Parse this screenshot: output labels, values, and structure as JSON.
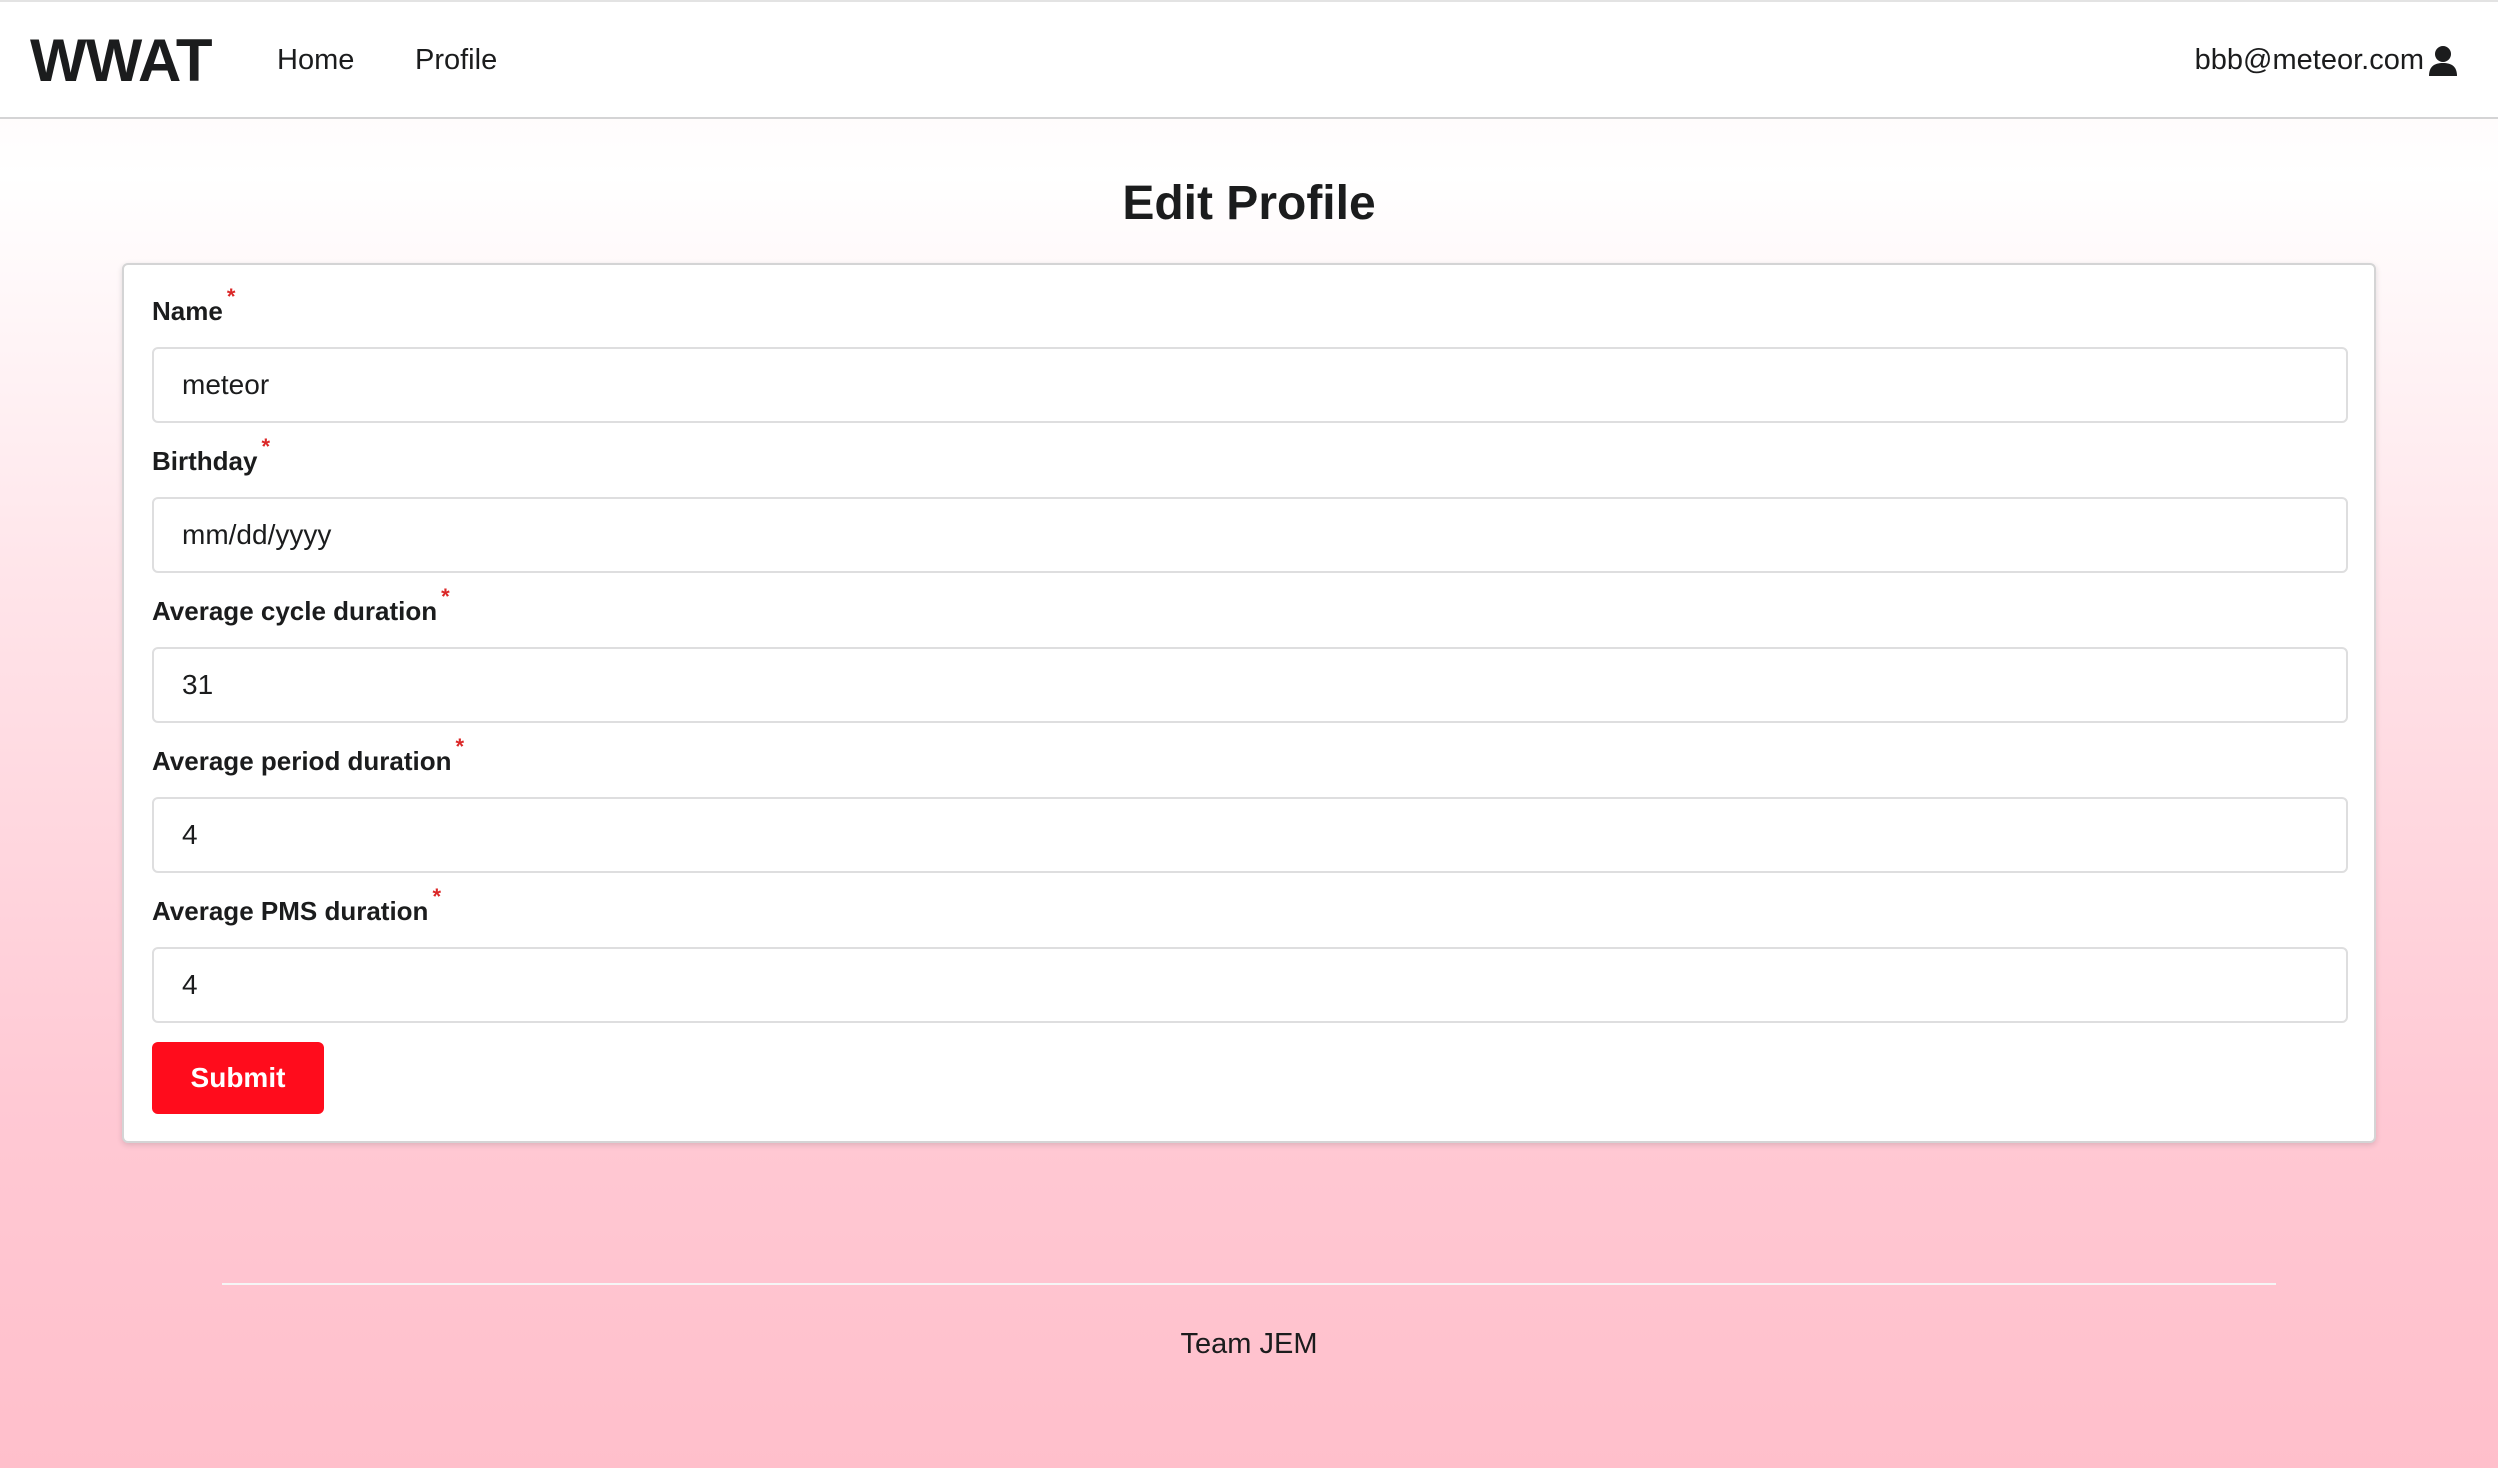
{
  "navbar": {
    "brand": "WWAT",
    "items": [
      {
        "label": "Home"
      },
      {
        "label": "Profile"
      }
    ],
    "user_email": "bbb@meteor.com",
    "user_icon": "user-icon"
  },
  "page": {
    "title": "Edit Profile"
  },
  "form": {
    "required_marker": "*",
    "fields": [
      {
        "label": "Name",
        "value": "meteor"
      },
      {
        "label": "Birthday",
        "value": "mm/dd/yyyy"
      },
      {
        "label": "Average cycle duration",
        "value": "31"
      },
      {
        "label": "Average period duration",
        "value": "4"
      },
      {
        "label": "Average PMS duration",
        "value": "4"
      }
    ],
    "submit_label": "Submit"
  },
  "footer": {
    "text": "Team JEM"
  },
  "colors": {
    "accent": "#ff0c1c",
    "required": "#db2828"
  }
}
